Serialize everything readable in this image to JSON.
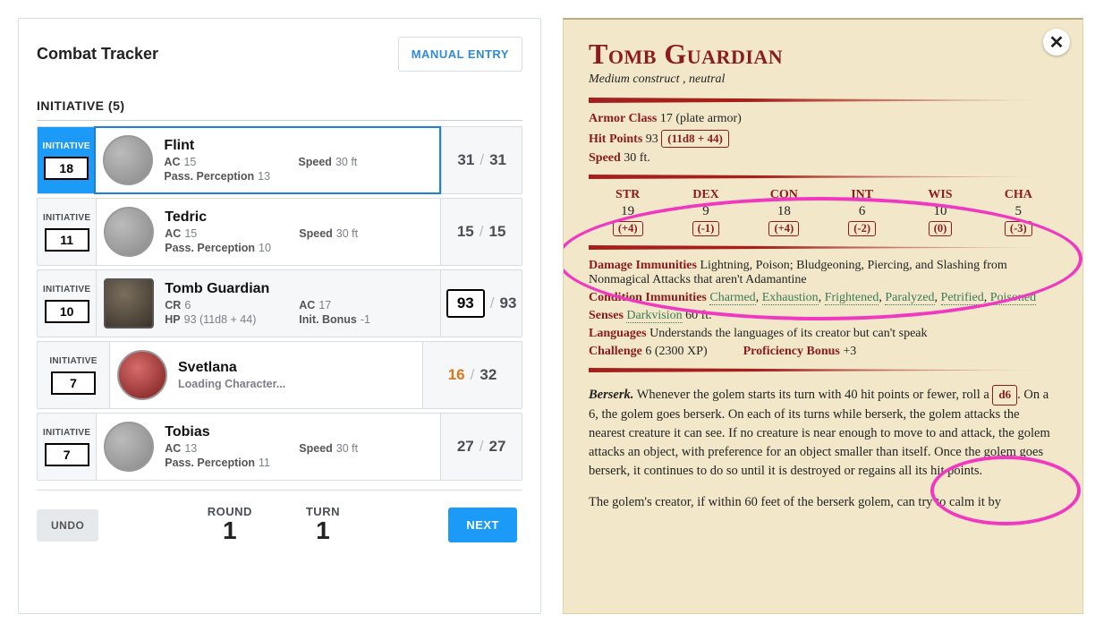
{
  "tracker": {
    "title": "Combat Tracker",
    "manual_entry": "MANUAL ENTRY",
    "init_heading": "INITIATIVE (5)",
    "init_label": "INITIATIVE",
    "undo": "UNDO",
    "next": "NEXT",
    "round_label": "ROUND",
    "round": "1",
    "turn_label": "TURN",
    "turn": "1",
    "labels": {
      "ac": "AC",
      "speed": "Speed",
      "pp": "Pass. Perception",
      "cr": "CR",
      "hp": "HP",
      "initb": "Init. Bonus"
    },
    "rows": [
      {
        "kind": "pc",
        "active": true,
        "name": "Flint",
        "initiative": "18",
        "ac": "15",
        "speed": "30 ft",
        "pp": "13",
        "hp_cur": "31",
        "hp_max": "31"
      },
      {
        "kind": "pc",
        "name": "Tedric",
        "initiative": "11",
        "ac": "15",
        "speed": "30 ft",
        "pp": "10",
        "hp_cur": "15",
        "hp_max": "15"
      },
      {
        "kind": "monster",
        "name": "Tomb Guardian",
        "initiative": "10",
        "cr": "6",
        "ac": "17",
        "hp_formula": "93 (11d8 + 44)",
        "init_bonus": "-1",
        "hp_cur": "93",
        "hp_max": "93",
        "hp_boxed": true
      },
      {
        "kind": "loading",
        "name": "Svetlana",
        "initiative": "7",
        "loading_text": "Loading Character...",
        "hp_cur": "16",
        "hp_max": "32",
        "hp_low": true
      },
      {
        "kind": "pc",
        "name": "Tobias",
        "initiative": "7",
        "ac": "13",
        "speed": "30 ft",
        "pp": "11",
        "hp_cur": "27",
        "hp_max": "27"
      }
    ]
  },
  "stat": {
    "name": "Tomb Guardian",
    "type": "Medium construct , neutral",
    "ac_label": "Armor Class",
    "ac": "17 (plate armor)",
    "hp_label": "Hit Points",
    "hp": "93",
    "hp_roll": "(11d8 + 44)",
    "speed_label": "Speed",
    "speed": "30 ft.",
    "abilities": [
      {
        "h": "STR",
        "v": "19",
        "m": "(+4)"
      },
      {
        "h": "DEX",
        "v": "9",
        "m": "(-1)"
      },
      {
        "h": "CON",
        "v": "18",
        "m": "(+4)"
      },
      {
        "h": "INT",
        "v": "6",
        "m": "(-2)"
      },
      {
        "h": "WIS",
        "v": "10",
        "m": "(0)"
      },
      {
        "h": "CHA",
        "v": "5",
        "m": "(-3)"
      }
    ],
    "dmg_imm_label": "Damage Immunities",
    "dmg_imm": "Lightning, Poison; Bludgeoning, Piercing, and Slashing from Nonmagical Attacks that aren't Adamantine",
    "cond_imm_label": "Condition Immunities",
    "cond_imm": [
      "Charmed",
      "Exhaustion",
      "Frightened",
      "Paralyzed",
      "Petrified",
      "Poisoned"
    ],
    "senses_label": "Senses",
    "senses_link": "Darkvision",
    "senses_rest": "60 ft.",
    "lang_label": "Languages",
    "lang": "Understands the languages of its creator but can't speak",
    "challenge_label": "Challenge",
    "challenge": "6 (2300 XP)",
    "prof_label": "Proficiency Bonus",
    "prof": "+3",
    "berserk_name": "Berserk.",
    "berserk_pre": "Whenever the golem starts its turn with 40 hit points or fewer, roll a ",
    "berserk_roll": "d6",
    "berserk_post": ". On a 6, the golem goes berserk. On each of its turns while berserk, the golem attacks the nearest creature it can see. If no creature is near enough to move to and attack, the golem attacks an object, with preference for an object smaller than itself. Once the golem goes berserk, it continues to do so until it is destroyed or regains all its hit points.",
    "berserk_p2": "The golem's creator, if within 60 feet of the berserk golem, can try to calm it by"
  }
}
